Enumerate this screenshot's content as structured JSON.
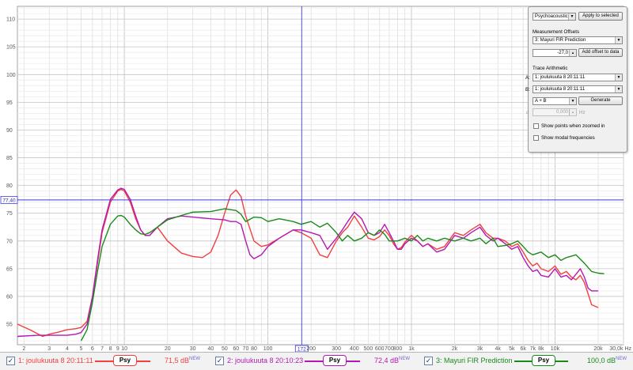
{
  "chart_data": {
    "type": "line",
    "x_scale": "log",
    "xlim": [
      1.8,
      30000
    ],
    "ylim": [
      51.3,
      112.3
    ],
    "y_ticks": [
      55,
      60,
      65,
      70,
      75,
      80,
      85,
      90,
      95,
      100,
      105,
      110
    ],
    "x_ticks": [
      {
        "v": 2,
        "label": "2"
      },
      {
        "v": 3,
        "label": "3"
      },
      {
        "v": 4,
        "label": "4"
      },
      {
        "v": 5,
        "label": "5"
      },
      {
        "v": 6,
        "label": "6"
      },
      {
        "v": 7,
        "label": "7"
      },
      {
        "v": 8,
        "label": "8"
      },
      {
        "v": 9,
        "label": "9"
      },
      {
        "v": 10,
        "label": "10"
      },
      {
        "v": 20,
        "label": "20"
      },
      {
        "v": 30,
        "label": "30"
      },
      {
        "v": 40,
        "label": "40"
      },
      {
        "v": 50,
        "label": "50"
      },
      {
        "v": 60,
        "label": "60"
      },
      {
        "v": 70,
        "label": "70"
      },
      {
        "v": 80,
        "label": "80"
      },
      {
        "v": 100,
        "label": "100"
      },
      {
        "v": 200,
        "label": "200"
      },
      {
        "v": 300,
        "label": "300"
      },
      {
        "v": 400,
        "label": "400"
      },
      {
        "v": 500,
        "label": "500"
      },
      {
        "v": 600,
        "label": "600"
      },
      {
        "v": 700,
        "label": "700"
      },
      {
        "v": 800,
        "label": "800"
      },
      {
        "v": 1000,
        "label": "1k"
      },
      {
        "v": 2000,
        "label": "2k"
      },
      {
        "v": 3000,
        "label": "3k"
      },
      {
        "v": 4000,
        "label": "4k"
      },
      {
        "v": 5000,
        "label": "5k"
      },
      {
        "v": 6000,
        "label": "6k"
      },
      {
        "v": 7000,
        "label": "7k"
      },
      {
        "v": 8000,
        "label": "8k"
      },
      {
        "v": 10000,
        "label": "10k"
      },
      {
        "v": 20000,
        "label": "20k"
      }
    ],
    "x_end_label": "30,0k Hz",
    "cursor": {
      "x": 172,
      "y": 77.4,
      "x_label": "172",
      "y_label": "77,40"
    },
    "grid": true,
    "series": [
      {
        "name": "1: joulukuuta 8 20:11:11",
        "color": "#f04040",
        "points": [
          [
            1.8,
            55.0
          ],
          [
            2.2,
            54.0
          ],
          [
            2.7,
            52.8
          ],
          [
            3.0,
            53.2
          ],
          [
            3.5,
            53.6
          ],
          [
            4.0,
            54.0
          ],
          [
            4.6,
            54.2
          ],
          [
            5.0,
            54.4
          ],
          [
            5.5,
            55.5
          ],
          [
            6.0,
            60.0
          ],
          [
            6.5,
            66.0
          ],
          [
            7.0,
            71.5
          ],
          [
            8.0,
            77.0
          ],
          [
            9.0,
            79.0
          ],
          [
            9.5,
            79.3
          ],
          [
            10.0,
            79.0
          ],
          [
            11.0,
            77.0
          ],
          [
            12.0,
            74.0
          ],
          [
            13.0,
            72.0
          ],
          [
            14.0,
            71.0
          ],
          [
            15.0,
            71.0
          ],
          [
            17.0,
            72.5
          ],
          [
            20.0,
            70.0
          ],
          [
            25.0,
            67.8
          ],
          [
            30.0,
            67.2
          ],
          [
            35.0,
            67.0
          ],
          [
            40.0,
            68.0
          ],
          [
            45.0,
            71.0
          ],
          [
            50.0,
            75.0
          ],
          [
            55.0,
            78.3
          ],
          [
            60.0,
            79.2
          ],
          [
            65.0,
            78.0
          ],
          [
            70.0,
            74.5
          ],
          [
            80.0,
            70.0
          ],
          [
            90.0,
            69.0
          ],
          [
            100.0,
            69.3
          ],
          [
            120.0,
            70.5
          ],
          [
            150.0,
            72.0
          ],
          [
            170.0,
            71.5
          ],
          [
            200.0,
            70.5
          ],
          [
            230.0,
            67.5
          ],
          [
            260.0,
            67.0
          ],
          [
            300.0,
            70.0
          ],
          [
            330.0,
            71.5
          ],
          [
            360.0,
            72.5
          ],
          [
            400.0,
            74.5
          ],
          [
            450.0,
            72.5
          ],
          [
            500.0,
            70.5
          ],
          [
            550.0,
            70.2
          ],
          [
            600.0,
            70.8
          ],
          [
            650.0,
            72.0
          ],
          [
            700.0,
            71.0
          ],
          [
            750.0,
            69.5
          ],
          [
            800.0,
            68.5
          ],
          [
            850.0,
            68.8
          ],
          [
            900.0,
            69.8
          ],
          [
            1000.0,
            71.0
          ],
          [
            1100.0,
            70.0
          ],
          [
            1200.0,
            69.0
          ],
          [
            1300.0,
            69.5
          ],
          [
            1500.0,
            68.5
          ],
          [
            1700.0,
            69.0
          ],
          [
            2000.0,
            71.5
          ],
          [
            2300.0,
            71.0
          ],
          [
            2600.0,
            72.0
          ],
          [
            3000.0,
            73.0
          ],
          [
            3300.0,
            71.5
          ],
          [
            3700.0,
            70.5
          ],
          [
            4000.0,
            70.5
          ],
          [
            4500.0,
            70.0
          ],
          [
            5000.0,
            69.0
          ],
          [
            5500.0,
            69.5
          ],
          [
            6000.0,
            68.0
          ],
          [
            6500.0,
            66.5
          ],
          [
            7000.0,
            65.5
          ],
          [
            7500.0,
            66.0
          ],
          [
            8000.0,
            65.0
          ],
          [
            9000.0,
            64.5
          ],
          [
            10000.0,
            65.5
          ],
          [
            11000.0,
            64.0
          ],
          [
            12000.0,
            64.5
          ],
          [
            13000.0,
            63.5
          ],
          [
            14000.0,
            63.0
          ],
          [
            15000.0,
            63.8
          ],
          [
            16000.0,
            62.5
          ],
          [
            17000.0,
            60.5
          ],
          [
            18000.0,
            58.5
          ],
          [
            20000.0,
            58.0
          ]
        ]
      },
      {
        "name": "2: joulukuuta 8 20:10:23",
        "color": "#b418b4",
        "points": [
          [
            1.8,
            52.8
          ],
          [
            2.5,
            53.0
          ],
          [
            3.0,
            53.0
          ],
          [
            3.5,
            53.0
          ],
          [
            4.0,
            53.0
          ],
          [
            4.6,
            53.2
          ],
          [
            5.0,
            53.5
          ],
          [
            5.5,
            55.0
          ],
          [
            6.0,
            60.0
          ],
          [
            6.5,
            66.5
          ],
          [
            7.0,
            72.0
          ],
          [
            8.0,
            77.5
          ],
          [
            9.0,
            79.2
          ],
          [
            9.5,
            79.5
          ],
          [
            10.0,
            79.3
          ],
          [
            11.0,
            77.5
          ],
          [
            12.0,
            74.5
          ],
          [
            13.0,
            72.0
          ],
          [
            14.0,
            71.0
          ],
          [
            15.0,
            71.0
          ],
          [
            17.0,
            72.5
          ],
          [
            20.0,
            74.0
          ],
          [
            25.0,
            74.5
          ],
          [
            30.0,
            74.3
          ],
          [
            40.0,
            74.0
          ],
          [
            50.0,
            73.8
          ],
          [
            55.0,
            73.5
          ],
          [
            60.0,
            73.5
          ],
          [
            65.0,
            73.0
          ],
          [
            70.0,
            70.0
          ],
          [
            75.0,
            67.5
          ],
          [
            80.0,
            66.8
          ],
          [
            90.0,
            67.5
          ],
          [
            100.0,
            69.0
          ],
          [
            120.0,
            70.5
          ],
          [
            150.0,
            72.0
          ],
          [
            170.0,
            72.0
          ],
          [
            200.0,
            71.5
          ],
          [
            230.0,
            71.0
          ],
          [
            260.0,
            68.5
          ],
          [
            300.0,
            70.5
          ],
          [
            330.0,
            72.0
          ],
          [
            360.0,
            73.5
          ],
          [
            400.0,
            75.2
          ],
          [
            450.0,
            74.0
          ],
          [
            500.0,
            71.5
          ],
          [
            550.0,
            71.0
          ],
          [
            600.0,
            71.5
          ],
          [
            650.0,
            73.0
          ],
          [
            700.0,
            71.5
          ],
          [
            750.0,
            70.0
          ],
          [
            800.0,
            68.5
          ],
          [
            850.0,
            68.5
          ],
          [
            900.0,
            69.5
          ],
          [
            1000.0,
            70.5
          ],
          [
            1100.0,
            70.0
          ],
          [
            1200.0,
            69.0
          ],
          [
            1300.0,
            69.5
          ],
          [
            1500.0,
            68.0
          ],
          [
            1700.0,
            68.5
          ],
          [
            2000.0,
            71.0
          ],
          [
            2300.0,
            70.5
          ],
          [
            2600.0,
            71.5
          ],
          [
            3000.0,
            72.5
          ],
          [
            3300.0,
            71.0
          ],
          [
            3700.0,
            70.0
          ],
          [
            4000.0,
            70.5
          ],
          [
            4500.0,
            69.5
          ],
          [
            5000.0,
            68.5
          ],
          [
            5500.0,
            69.0
          ],
          [
            6000.0,
            67.0
          ],
          [
            6500.0,
            65.5
          ],
          [
            7000.0,
            64.5
          ],
          [
            7500.0,
            64.8
          ],
          [
            8000.0,
            63.8
          ],
          [
            9000.0,
            63.5
          ],
          [
            10000.0,
            65.0
          ],
          [
            11000.0,
            63.5
          ],
          [
            12000.0,
            63.8
          ],
          [
            13000.0,
            63.0
          ],
          [
            14000.0,
            64.0
          ],
          [
            15000.0,
            65.0
          ],
          [
            16000.0,
            63.5
          ],
          [
            17000.0,
            61.5
          ],
          [
            18000.0,
            61.0
          ],
          [
            20000.0,
            61.0
          ]
        ]
      },
      {
        "name": "3: Mayuri FIR Prediction",
        "color": "#1a8a1a",
        "points": [
          [
            5.0,
            52.0
          ],
          [
            5.5,
            54.0
          ],
          [
            6.0,
            59.0
          ],
          [
            6.5,
            64.5
          ],
          [
            7.0,
            69.0
          ],
          [
            8.0,
            73.0
          ],
          [
            9.0,
            74.5
          ],
          [
            9.5,
            74.6
          ],
          [
            10.0,
            74.3
          ],
          [
            11.0,
            73.0
          ],
          [
            12.0,
            72.0
          ],
          [
            13.0,
            71.3
          ],
          [
            14.0,
            71.2
          ],
          [
            15.0,
            71.5
          ],
          [
            17.0,
            72.5
          ],
          [
            20.0,
            73.8
          ],
          [
            25.0,
            74.6
          ],
          [
            30.0,
            75.2
          ],
          [
            40.0,
            75.3
          ],
          [
            50.0,
            75.8
          ],
          [
            60.0,
            75.5
          ],
          [
            65.0,
            74.8
          ],
          [
            70.0,
            73.5
          ],
          [
            80.0,
            74.3
          ],
          [
            90.0,
            74.2
          ],
          [
            100.0,
            73.5
          ],
          [
            120.0,
            74.0
          ],
          [
            150.0,
            73.5
          ],
          [
            170.0,
            73.0
          ],
          [
            200.0,
            73.5
          ],
          [
            230.0,
            72.5
          ],
          [
            260.0,
            73.2
          ],
          [
            300.0,
            71.5
          ],
          [
            330.0,
            70.0
          ],
          [
            360.0,
            71.0
          ],
          [
            400.0,
            70.0
          ],
          [
            450.0,
            70.5
          ],
          [
            500.0,
            71.5
          ],
          [
            550.0,
            71.0
          ],
          [
            600.0,
            72.0
          ],
          [
            650.0,
            71.2
          ],
          [
            700.0,
            70.0
          ],
          [
            800.0,
            70.0
          ],
          [
            900.0,
            70.5
          ],
          [
            1000.0,
            70.0
          ],
          [
            1100.0,
            71.0
          ],
          [
            1200.0,
            70.0
          ],
          [
            1300.0,
            70.5
          ],
          [
            1500.0,
            70.0
          ],
          [
            1700.0,
            70.5
          ],
          [
            2000.0,
            70.0
          ],
          [
            2300.0,
            70.5
          ],
          [
            2600.0,
            70.0
          ],
          [
            3000.0,
            70.5
          ],
          [
            3300.0,
            69.5
          ],
          [
            3700.0,
            70.5
          ],
          [
            4000.0,
            69.0
          ],
          [
            4500.0,
            69.2
          ],
          [
            5000.0,
            69.5
          ],
          [
            5500.0,
            70.0
          ],
          [
            6000.0,
            69.0
          ],
          [
            6500.0,
            68.0
          ],
          [
            7000.0,
            67.5
          ],
          [
            8000.0,
            68.0
          ],
          [
            9000.0,
            67.0
          ],
          [
            10000.0,
            67.5
          ],
          [
            11000.0,
            66.5
          ],
          [
            12000.0,
            67.0
          ],
          [
            14000.0,
            67.5
          ],
          [
            16000.0,
            66.0
          ],
          [
            18000.0,
            64.5
          ],
          [
            20000.0,
            64.2
          ],
          [
            22000.0,
            64.1
          ]
        ]
      }
    ]
  },
  "panel": {
    "mode_select": "Psychoacoustic",
    "apply_button": "Apply to selected",
    "offsets_heading": "Measurement Offsets",
    "offset_target": "3: Mayuri FIR Prediction",
    "offset_value": "-27,0",
    "add_offset_button": "Add offset to data",
    "arithmetic_heading": "Trace Arithmetic",
    "label_a": "A:",
    "trace_a": "1: joulukuuta 8 20:11:11",
    "label_b": "B:",
    "trace_b": "1: joulukuuta 8 20:11:11",
    "operation": "A + B",
    "generate_button": "Generate",
    "alpha_label": "α",
    "alpha_value": "0,000",
    "alpha_unit": "Hz",
    "show_points_label": "Show points when zoomed in",
    "show_modal_label": "Show modal frequencies"
  },
  "legend": {
    "psy_label": "Psy",
    "new_tag": "NEW",
    "items": [
      {
        "name": "1: joulukuuta 8 20:11:11",
        "db": "71,5 dB",
        "color": "#f04040"
      },
      {
        "name": "2: joulukuuta 8 20:10:23",
        "db": "72,4 dB",
        "color": "#b418b4"
      },
      {
        "name": "3: Mayuri FIR Prediction",
        "db": "100,0 dB",
        "color": "#1a8a1a"
      }
    ]
  }
}
